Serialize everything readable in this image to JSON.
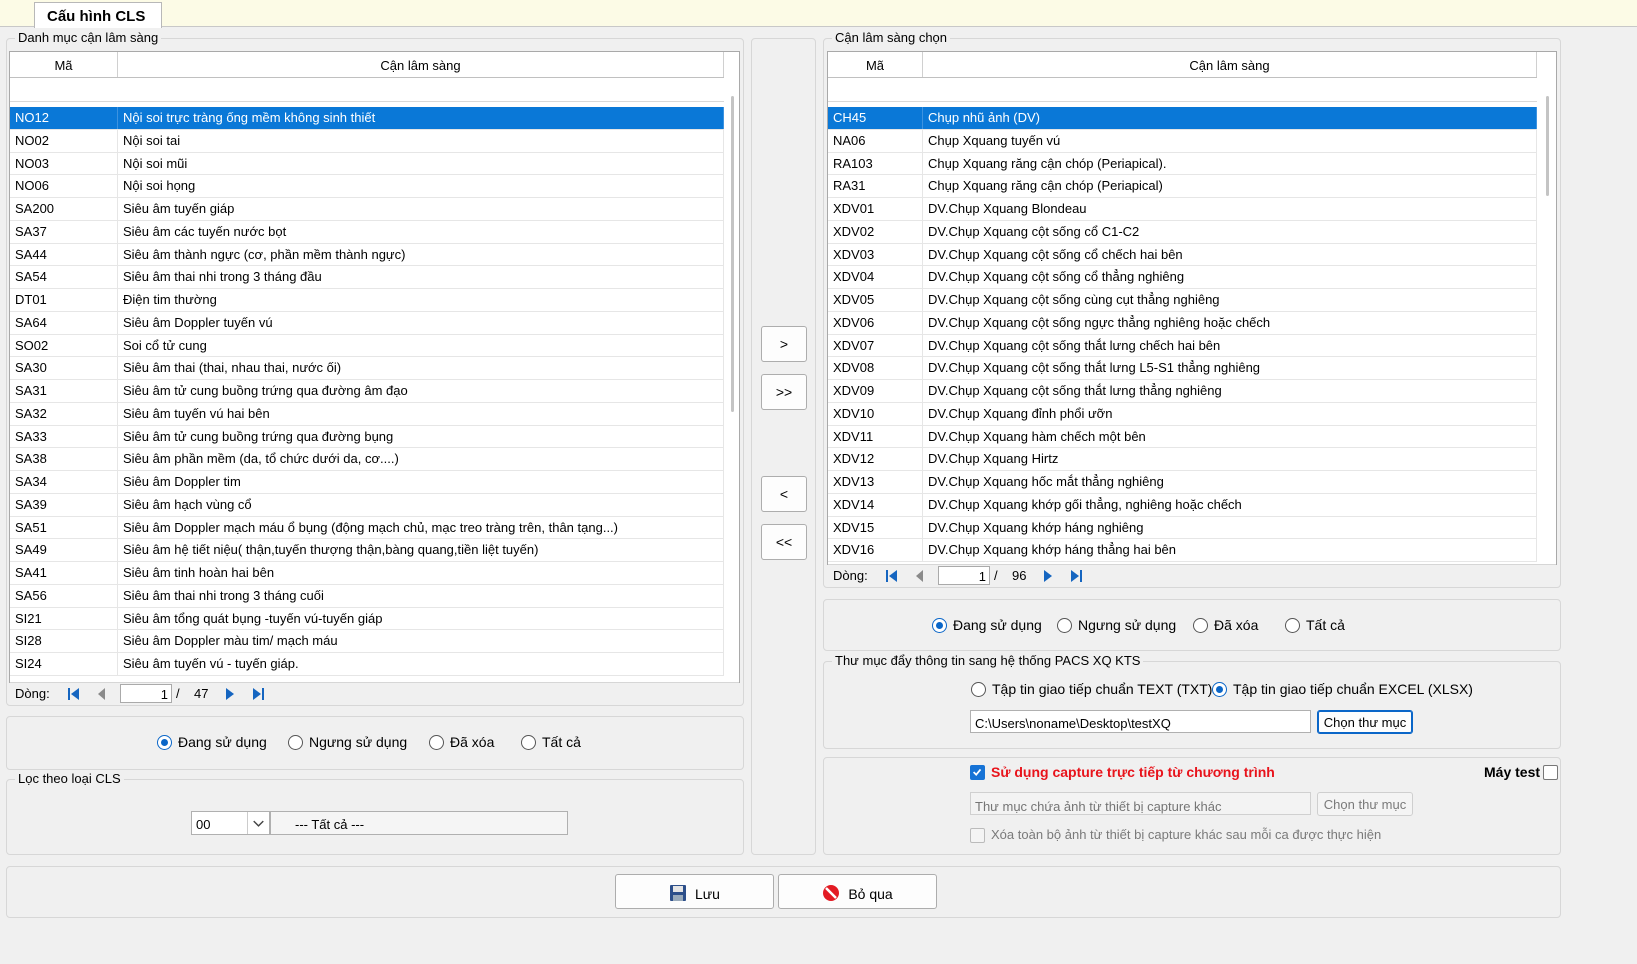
{
  "tab": {
    "label": "Cấu hình CLS"
  },
  "left": {
    "group_title": "Danh mục cận lâm sàng",
    "col_code": "Mã",
    "col_name": "Cận lâm sàng",
    "rows": [
      [
        "NO12",
        "Nội soi trực tràng ống mềm không sinh thiết"
      ],
      [
        "NO02",
        "Nội soi tai"
      ],
      [
        "NO03",
        "Nội soi mũi"
      ],
      [
        "NO06",
        "Nội soi họng"
      ],
      [
        "SA200",
        "Siêu âm tuyến giáp"
      ],
      [
        "SA37",
        "Siêu âm các tuyến nước bọt"
      ],
      [
        "SA44",
        "Siêu âm thành ngực (cơ, phần mềm thành ngực)"
      ],
      [
        "SA54",
        "Siêu âm thai nhi trong 3 tháng đầu"
      ],
      [
        "DT01",
        "Điện tim thường"
      ],
      [
        "SA64",
        "Siêu âm Doppler tuyến vú"
      ],
      [
        "SO02",
        "Soi cổ tử cung"
      ],
      [
        "SA30",
        "Siêu âm thai (thai, nhau thai, nước ối)"
      ],
      [
        "SA31",
        "Siêu âm tử cung buồng trứng qua đường âm đạo"
      ],
      [
        "SA32",
        "Siêu âm tuyến vú hai bên"
      ],
      [
        "SA33",
        "Siêu âm tử cung buồng trứng qua đường bụng"
      ],
      [
        "SA38",
        "Siêu âm phần mềm (da, tổ chức dưới da, cơ....)"
      ],
      [
        "SA34",
        "Siêu âm Doppler tim"
      ],
      [
        "SA39",
        "Siêu âm hạch vùng cổ"
      ],
      [
        "SA51",
        "Siêu âm Doppler mạch máu ổ bụng (động mạch chủ, mạc treo tràng trên, thân tạng...)"
      ],
      [
        "SA49",
        "Siêu âm hệ tiết niệu( thận,tuyến thượng thận,bàng quang,tiền liệt tuyến)"
      ],
      [
        "SA41",
        "Siêu âm tinh hoàn hai bên"
      ],
      [
        "SA56",
        "Siêu âm thai nhi trong 3 tháng cuối"
      ],
      [
        "SI21",
        "Siêu âm tổng quát bụng -tuyến vú-tuyến giáp"
      ],
      [
        "SI28",
        "Siêu âm Doppler màu tim/ mạch máu"
      ],
      [
        "SI24",
        "Siêu âm tuyến vú - tuyến giáp."
      ]
    ],
    "selected_index": 0,
    "nav_label": "Dòng:",
    "page": "1",
    "total": "47",
    "radios": [
      "Đang sử dụng",
      "Ngưng sử dụng",
      "Đã xóa",
      "Tất cả"
    ],
    "radio_selected": 0,
    "filter_title": "Lọc theo loại CLS",
    "filter_code": "00",
    "filter_text": "--- Tất cả ---"
  },
  "middle": {
    "add": ">",
    "add_all": ">>",
    "remove": "<",
    "remove_all": "<<"
  },
  "right": {
    "group_title": "Cận lâm sàng chọn",
    "col_code": "Mã",
    "col_name": "Cận lâm sàng",
    "rows": [
      [
        "CH45",
        "Chụp nhũ ảnh (DV)"
      ],
      [
        "NA06",
        "Chụp Xquang tuyến vú"
      ],
      [
        "RA103",
        "Chụp Xquang răng cận chóp (Periapical)."
      ],
      [
        "RA31",
        "Chụp Xquang răng cận chóp (Periapical)"
      ],
      [
        "XDV01",
        "DV.Chụp Xquang Blondeau"
      ],
      [
        "XDV02",
        "DV.Chụp Xquang cột sống cổ C1-C2"
      ],
      [
        "XDV03",
        "DV.Chụp Xquang cột sống cổ chếch hai bên"
      ],
      [
        "XDV04",
        "DV.Chụp Xquang cột sống cổ thẳng nghiêng"
      ],
      [
        "XDV05",
        "DV.Chụp Xquang cột sống cùng cụt thẳng nghiêng"
      ],
      [
        "XDV06",
        "DV.Chụp Xquang cột sống ngực thẳng nghiêng hoặc chếch"
      ],
      [
        "XDV07",
        "DV.Chụp Xquang cột sống thắt lưng chếch hai bên"
      ],
      [
        "XDV08",
        "DV.Chụp Xquang cột sống thắt lưng L5-S1 thẳng nghiêng"
      ],
      [
        "XDV09",
        "DV.Chụp Xquang cột sống thắt lưng thẳng nghiêng"
      ],
      [
        "XDV10",
        "DV.Chụp Xquang đỉnh phổi ưỡn"
      ],
      [
        "XDV11",
        "DV.Chụp Xquang hàm chếch một bên"
      ],
      [
        "XDV12",
        "DV.Chụp Xquang Hirtz"
      ],
      [
        "XDV13",
        "DV.Chụp Xquang hốc mắt thẳng nghiêng"
      ],
      [
        "XDV14",
        "DV.Chụp Xquang khớp gối thẳng, nghiêng hoặc chếch"
      ],
      [
        "XDV15",
        "DV.Chụp Xquang khớp háng nghiêng"
      ],
      [
        "XDV16",
        "DV.Chụp Xquang khớp háng thẳng hai bên"
      ]
    ],
    "selected_index": 0,
    "nav_label": "Dòng:",
    "page": "1",
    "total": "96",
    "radios": [
      "Đang sử dụng",
      "Ngưng sử dụng",
      "Đã xóa",
      "Tất cả"
    ],
    "radio_selected": 0
  },
  "pacs": {
    "title": "Thư mục đẩy thông tin sang hệ thống PACS XQ KTS",
    "opt_txt": "Tập tin giao tiếp chuẩn TEXT (TXT)",
    "opt_xlsx": "Tập tin giao tiếp chuẩn EXCEL (XLSX)",
    "path": "C:\\Users\\noname\\Desktop\\testXQ",
    "browse": "Chọn thư mục"
  },
  "capture": {
    "use_label": "Sử dụng capture trực tiếp từ chương trình",
    "test_label": "Máy test",
    "folder_placeholder": "Thư mục chứa ảnh từ thiết bị capture khác",
    "browse": "Chọn thư mục",
    "delete_label": "Xóa toàn bộ ảnh từ thiết bị capture khác sau mỗi ca được thực hiện"
  },
  "footer": {
    "save": "Lưu",
    "skip": "Bỏ qua"
  },
  "colors": {
    "selection": "#0a78d7",
    "accent_red": "#e8131b",
    "checkbox": "#1673d6"
  }
}
